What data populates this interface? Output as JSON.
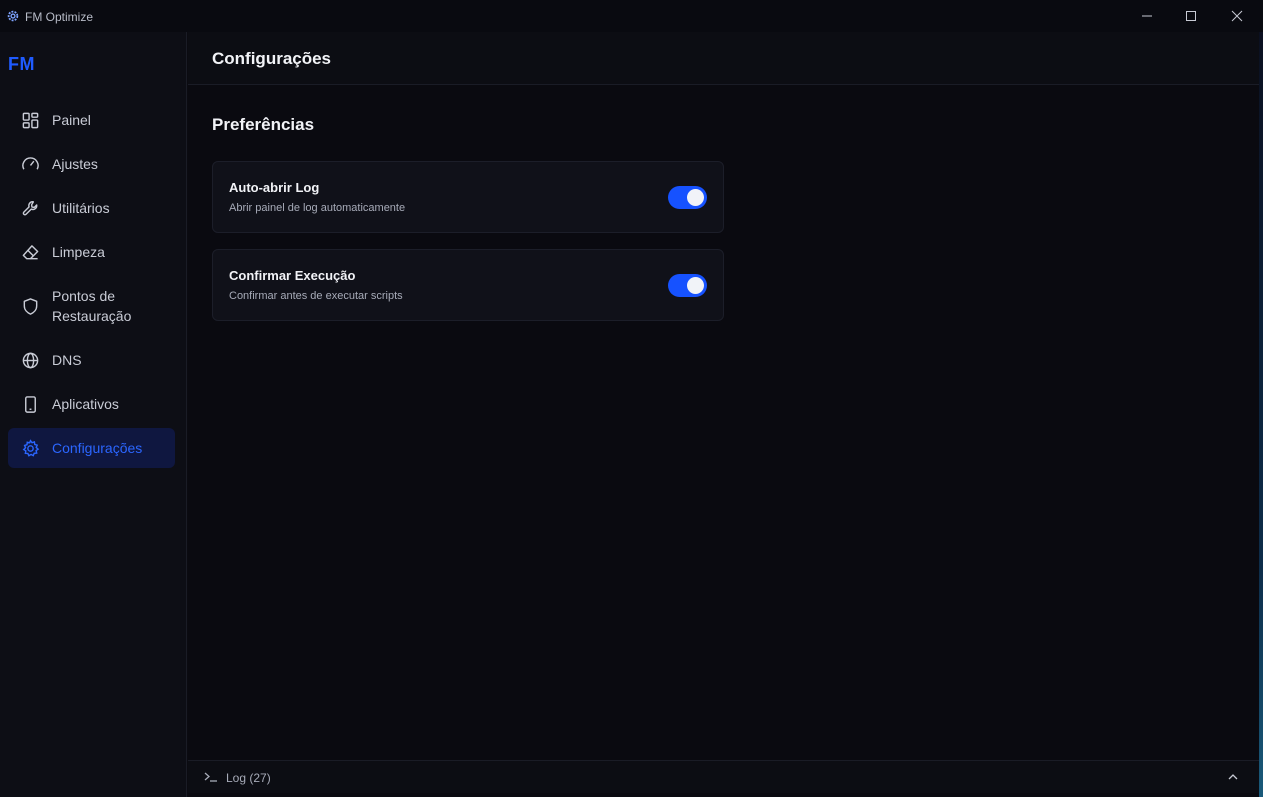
{
  "window": {
    "title": "FM Optimize",
    "controls": [
      "minimize",
      "maximize",
      "close"
    ]
  },
  "sidebar": {
    "logo": "FM",
    "items": [
      {
        "label": "Painel",
        "icon": "grid-icon",
        "active": false
      },
      {
        "label": "Ajustes",
        "icon": "gauge-icon",
        "active": false
      },
      {
        "label": "Utilitários",
        "icon": "wrench-icon",
        "active": false
      },
      {
        "label": "Limpeza",
        "icon": "eraser-icon",
        "active": false
      },
      {
        "label": "Pontos de",
        "label2": "Restauração",
        "icon": "shield-icon",
        "active": false
      },
      {
        "label": "DNS",
        "icon": "globe-icon",
        "active": false
      },
      {
        "label": "Aplicativos",
        "icon": "phone-icon",
        "active": false
      },
      {
        "label": "Configurações",
        "icon": "gear-icon",
        "active": true
      }
    ]
  },
  "main": {
    "title": "Configurações",
    "section_title": "Preferências",
    "settings": [
      {
        "title": "Auto-abrir Log",
        "description": "Abrir painel de log automaticamente",
        "enabled": true
      },
      {
        "title": "Confirmar Execução",
        "description": "Confirmar antes de executar scripts",
        "enabled": true
      }
    ]
  },
  "log": {
    "label": "Log (27)"
  },
  "colors": {
    "accent": "#1652ff",
    "active_bg": "#0f1740",
    "background": "#0a0a10"
  }
}
